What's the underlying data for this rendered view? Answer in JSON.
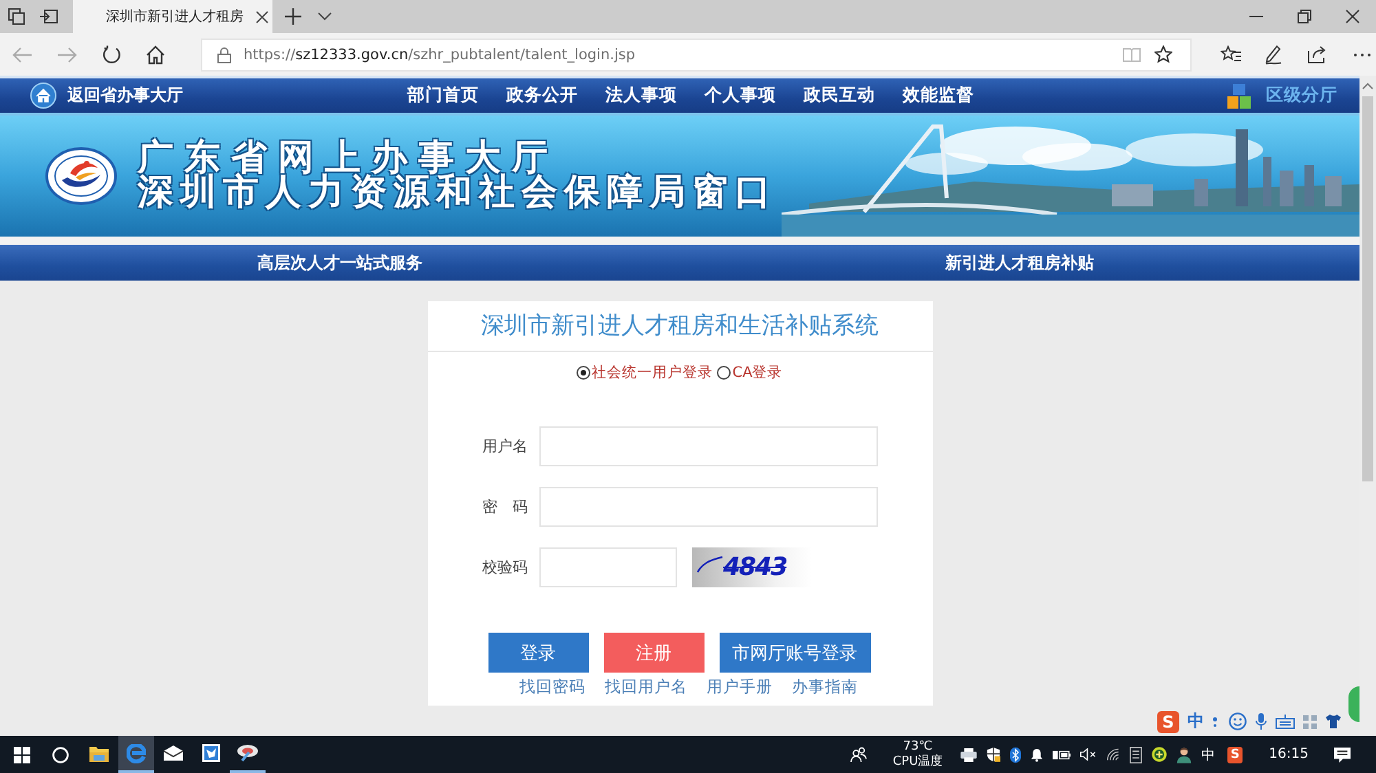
{
  "browser": {
    "tab_title": "深圳市新引进人才租房",
    "url_scheme": "https://",
    "url_domain": "sz12333.gov.cn",
    "url_path": "/szhr_pubtalent/talent_login.jsp"
  },
  "top_nav": {
    "home_link": "返回省办事大厅",
    "items": [
      "部门首页",
      "政务公开",
      "法人事项",
      "个人事项",
      "政民互动",
      "效能监督"
    ],
    "district_link": "区级分厅"
  },
  "banner": {
    "title_line_1": "广东省网上办事大厅",
    "title_line_2": "深圳市人力资源和社会保障局窗口"
  },
  "sub_nav": [
    "高层次人才一站式服务",
    "新引进人才租房补贴"
  ],
  "login": {
    "title": "深圳市新引进人才租房和生活补贴系统",
    "modes": [
      {
        "label": "社会统一用户登录",
        "selected": true
      },
      {
        "label": "CA登录",
        "selected": false
      }
    ],
    "fields": [
      {
        "label": "用户名",
        "kind": "text"
      },
      {
        "label": "密　码",
        "kind": "password"
      },
      {
        "label": "校验码",
        "kind": "captcha"
      }
    ],
    "captcha_code": "4843",
    "buttons": [
      {
        "label": "登录",
        "kind": "primary"
      },
      {
        "label": "注册",
        "kind": "danger"
      },
      {
        "label": "市网厅账号登录",
        "kind": "primary"
      }
    ],
    "links": [
      "找回密码",
      "找回用户名",
      "用户手册",
      "办事指南"
    ]
  },
  "ime_bar": {
    "logo": "S",
    "mode": "中"
  },
  "taskbar": {
    "apps": [
      {
        "kind": "folder",
        "active": false,
        "running": false
      },
      {
        "kind": "browser",
        "active": true,
        "running": true
      },
      {
        "kind": "mail",
        "active": false,
        "running": false
      },
      {
        "kind": "tile",
        "active": false,
        "running": false
      },
      {
        "kind": "disc",
        "active": false,
        "running": true
      }
    ],
    "cpu_temp": "73℃",
    "cpu_label": "CPU温度",
    "input_mode": "中",
    "ime_logo": "S",
    "clock": "16:15"
  }
}
